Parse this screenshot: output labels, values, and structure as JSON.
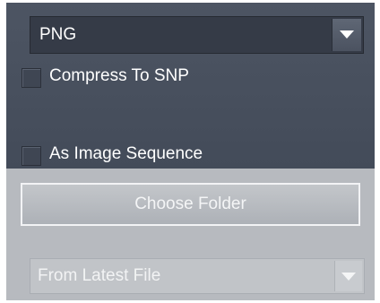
{
  "export_panel": {
    "format_select": {
      "value": "PNG"
    },
    "compress_checkbox": {
      "label": "Compress To SNP",
      "checked": false
    },
    "sequence_checkbox": {
      "label": "As Image Sequence",
      "checked": false
    },
    "choose_folder_button": {
      "label": "Choose Folder"
    },
    "source_select": {
      "value": "From Latest File",
      "enabled": false
    }
  },
  "colors": {
    "dark_panel": "#4d5563",
    "light_panel": "#b7babf",
    "text_light": "#ffffff"
  },
  "icons": [
    "chevron-down-icon"
  ]
}
